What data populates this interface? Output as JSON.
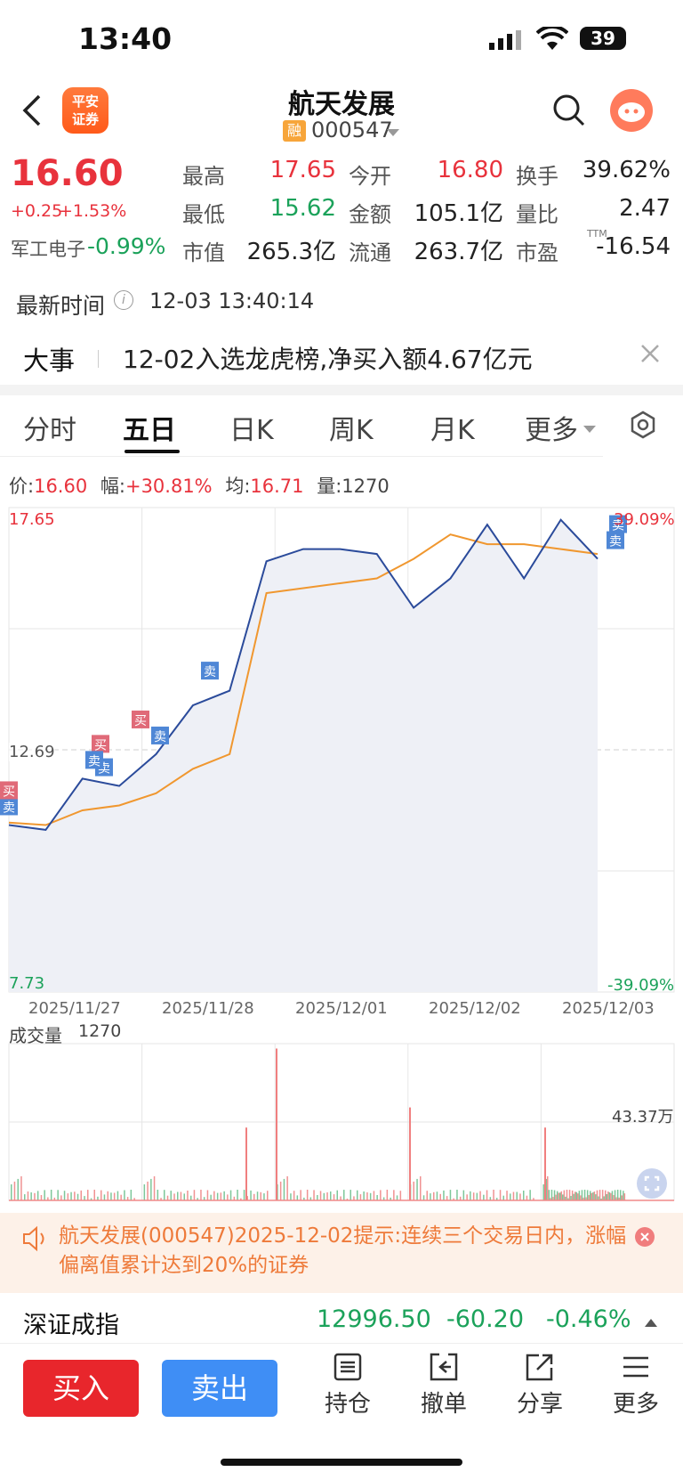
{
  "status_bar": {
    "time": "13:40",
    "battery": "39"
  },
  "header": {
    "broker_logo": "平安\n证券",
    "stock_name": "航天发展",
    "margin_badge": "融",
    "stock_code": "000547"
  },
  "quote": {
    "price": "16.60",
    "change": "+0.25",
    "change_pct": "+1.53%",
    "sector_name": "军工电子",
    "sector_change": "-0.99%",
    "fields": [
      {
        "label": "最高",
        "value": "17.65"
      },
      {
        "label": "今开",
        "value": "16.80"
      },
      {
        "label": "换手",
        "value": "39.62%"
      },
      {
        "label": "最低",
        "value": "15.62"
      },
      {
        "label": "金额",
        "value": "105.1亿"
      },
      {
        "label": "量比",
        "value": "2.47"
      },
      {
        "label": "市值",
        "value": "265.3亿"
      },
      {
        "label": "流通",
        "value": "263.7亿"
      },
      {
        "label": "市盈",
        "value": "-16.54"
      }
    ],
    "pe_superscript": "TTM"
  },
  "update": {
    "label": "最新时间",
    "time": "12-03 13:40:14"
  },
  "news": {
    "label": "大事",
    "text": "12-02入选龙虎榜,净买入额4.67亿元"
  },
  "chart_tabs": [
    "分时",
    "五日",
    "日K",
    "周K",
    "月K",
    "更多"
  ],
  "active_tab": "五日",
  "info_line": {
    "price_label": "价:",
    "price": "16.60",
    "range_label": "幅:",
    "range": "+30.81%",
    "avg_label": "均:",
    "avg": "16.71",
    "vol_label": "量:",
    "vol": "1270"
  },
  "chart_labels": {
    "high": "17.65",
    "low": "7.73",
    "high_pct": "39.09%",
    "low_pct": "-39.09%",
    "mid": "12.69"
  },
  "trade_marks": {
    "buy": "买",
    "sell": "卖"
  },
  "chart_data": {
    "type": "line",
    "x": [
      "2025/11/27",
      "2025/11/28",
      "2025/12/01",
      "2025/12/02",
      "2025/12/03"
    ],
    "ylim": [
      7.73,
      17.65
    ],
    "series": [
      {
        "values": [
          11.15,
          11.05,
          12.1,
          11.95,
          12.6,
          13.6,
          13.9,
          16.55,
          16.8,
          16.8,
          16.7,
          15.6,
          16.2,
          17.3,
          16.2,
          17.4,
          16.6
        ]
      },
      {
        "values": [
          11.2,
          11.15,
          11.45,
          11.55,
          11.8,
          12.3,
          12.6,
          15.9,
          16.0,
          16.1,
          16.2,
          16.6,
          17.1,
          16.9,
          16.9,
          16.8,
          16.7
        ]
      }
    ]
  },
  "volume": {
    "label": "成交量",
    "value": "1270",
    "scale": "43.37万"
  },
  "notice": {
    "text": "航天发展(000547)2025-12-02提示:连续三个交易日内，涨幅偏离值累计达到20%的证券"
  },
  "index": {
    "name": "深证成指",
    "value": "12996.50",
    "change": "-60.20",
    "change_pct": "-0.46%"
  },
  "bottom": {
    "buy": "买入",
    "sell": "卖出",
    "tools": [
      "持仓",
      "撤单",
      "分享",
      "更多"
    ]
  }
}
